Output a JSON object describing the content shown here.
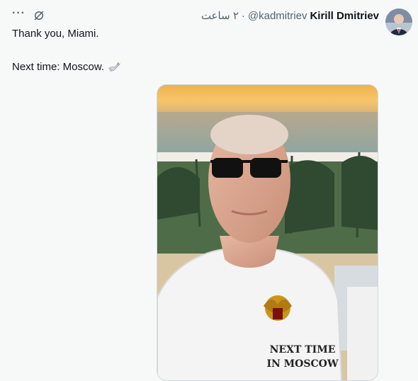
{
  "tweet": {
    "author_name": "Kirill Dmitriev",
    "author_handle": "@kadmitriev",
    "separator": "·",
    "time": "۲ ساعت",
    "text_line1": "Thank you, Miami.",
    "text_line2": "Next time: Moscow.",
    "more_icon": "···",
    "shirt_text_line1": "NEXT TIME",
    "shirt_text_line2": "IN MOSCOW"
  },
  "colors": {
    "name": "#0f1419",
    "meta": "#536471",
    "background": "#f7f9f9"
  },
  "icons": [
    "more-icon",
    "unlink-icon",
    "dove-icon",
    "double-headed-eagle-emblem"
  ]
}
